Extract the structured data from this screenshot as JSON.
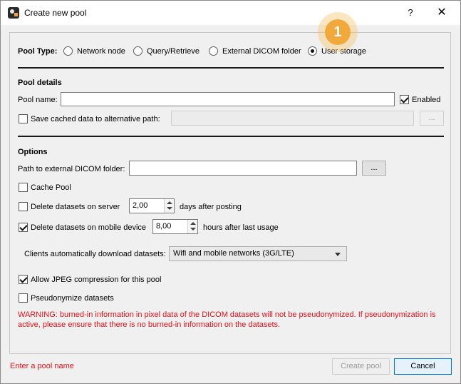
{
  "window": {
    "title": "Create new pool",
    "help_label": "?",
    "close_label": "✕"
  },
  "pool_type": {
    "label": "Pool Type:",
    "options": [
      "Network node",
      "Query/Retrieve",
      "External DICOM folder",
      "User storage"
    ],
    "selected": "User storage"
  },
  "pool_details": {
    "heading": "Pool details",
    "pool_name_label": "Pool name:",
    "pool_name_value": "",
    "enabled_label": "Enabled",
    "enabled_checked": true,
    "save_cached_label": "Save cached data to alternative path:",
    "save_cached_checked": false,
    "alt_path_value": "",
    "browse_label": "..."
  },
  "options": {
    "heading": "Options",
    "path_label": "Path to external DICOM folder:",
    "path_value": "",
    "browse_label": "...",
    "cache_pool_label": "Cache Pool",
    "delete_server_label": "Delete datasets on server",
    "delete_server_value": "2,00",
    "delete_server_suffix": "days after posting",
    "delete_mobile_label": "Delete datasets on mobile device",
    "delete_mobile_value": "8,00",
    "delete_mobile_suffix": "hours after last usage",
    "clients_label": "Clients automatically download datasets:",
    "clients_value": "Wifi and mobile networks (3G/LTE)",
    "jpeg_label": "Allow JPEG compression for this pool",
    "pseudonymize_label": "Pseudonymize datasets",
    "warning": "WARNING: burned-in information in pixel data of the DICOM datasets will not be pseudonymized. If pseudonymization is active, please ensure that there is no burned-in information on the datasets."
  },
  "footer": {
    "status": "Enter a pool name",
    "create_label": "Create pool",
    "cancel_label": "Cancel"
  },
  "badge": {
    "label": "1",
    "color": "#f2a93b"
  }
}
